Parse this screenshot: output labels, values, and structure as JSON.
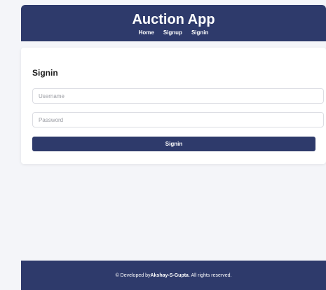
{
  "header": {
    "title": "Auction App",
    "nav": [
      "Home",
      "Signup",
      "Signin"
    ]
  },
  "signin": {
    "heading": "Signin",
    "username_placeholder": "Username",
    "password_placeholder": "Password",
    "submit_label": "Signin"
  },
  "footer": {
    "prefix": "© Developed by ",
    "author": "Akshay-S-Gupta",
    "suffix": ". All rights reserved."
  },
  "colors": {
    "brand": "#2e3a6b",
    "background": "#f4f5f9"
  }
}
